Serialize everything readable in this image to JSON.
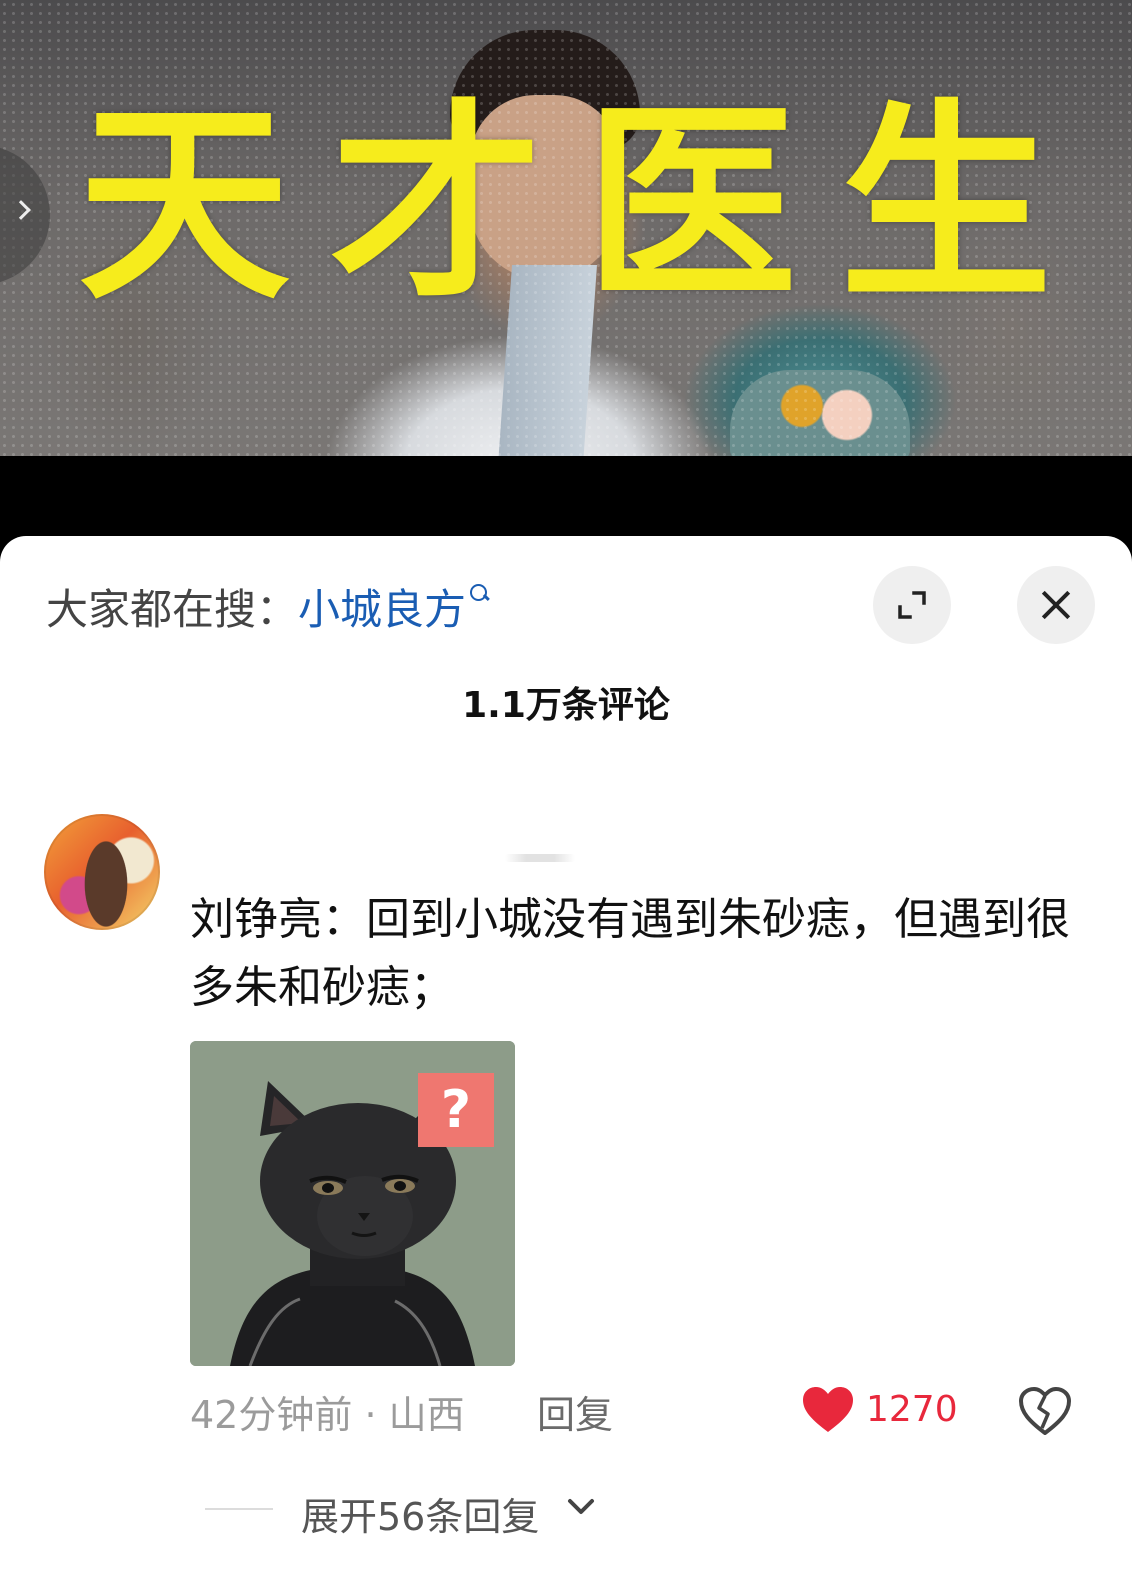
{
  "video": {
    "title_chars": [
      "天",
      "才",
      "医",
      "生"
    ]
  },
  "comments_sheet": {
    "search_hint_prefix": "大家都在搜：",
    "search_keyword": "小城良方",
    "comment_count_label": "1.1万条评论",
    "comment": {
      "author_and_text": "刘铮亮：回到小城没有遇到朱砂痣，但遇到很多朱和砂痣；",
      "meme_badge": "?",
      "time": "42分钟前",
      "separator": "·",
      "location": "山西",
      "reply_label": "回复",
      "like_count": "1270",
      "liked": true,
      "expand_replies_label": "展开56条回复"
    }
  },
  "colors": {
    "title_yellow": "#f6ec1c",
    "keyword_blue": "#1a5db3",
    "like_red": "#e8283c"
  },
  "icons": {
    "side_arrow": "chevron-right-icon",
    "search": "search-icon",
    "expand": "expand-icon",
    "close": "close-icon",
    "like": "heart-filled-icon",
    "dislike": "broken-heart-icon",
    "expand_chevron": "chevron-down-icon"
  }
}
